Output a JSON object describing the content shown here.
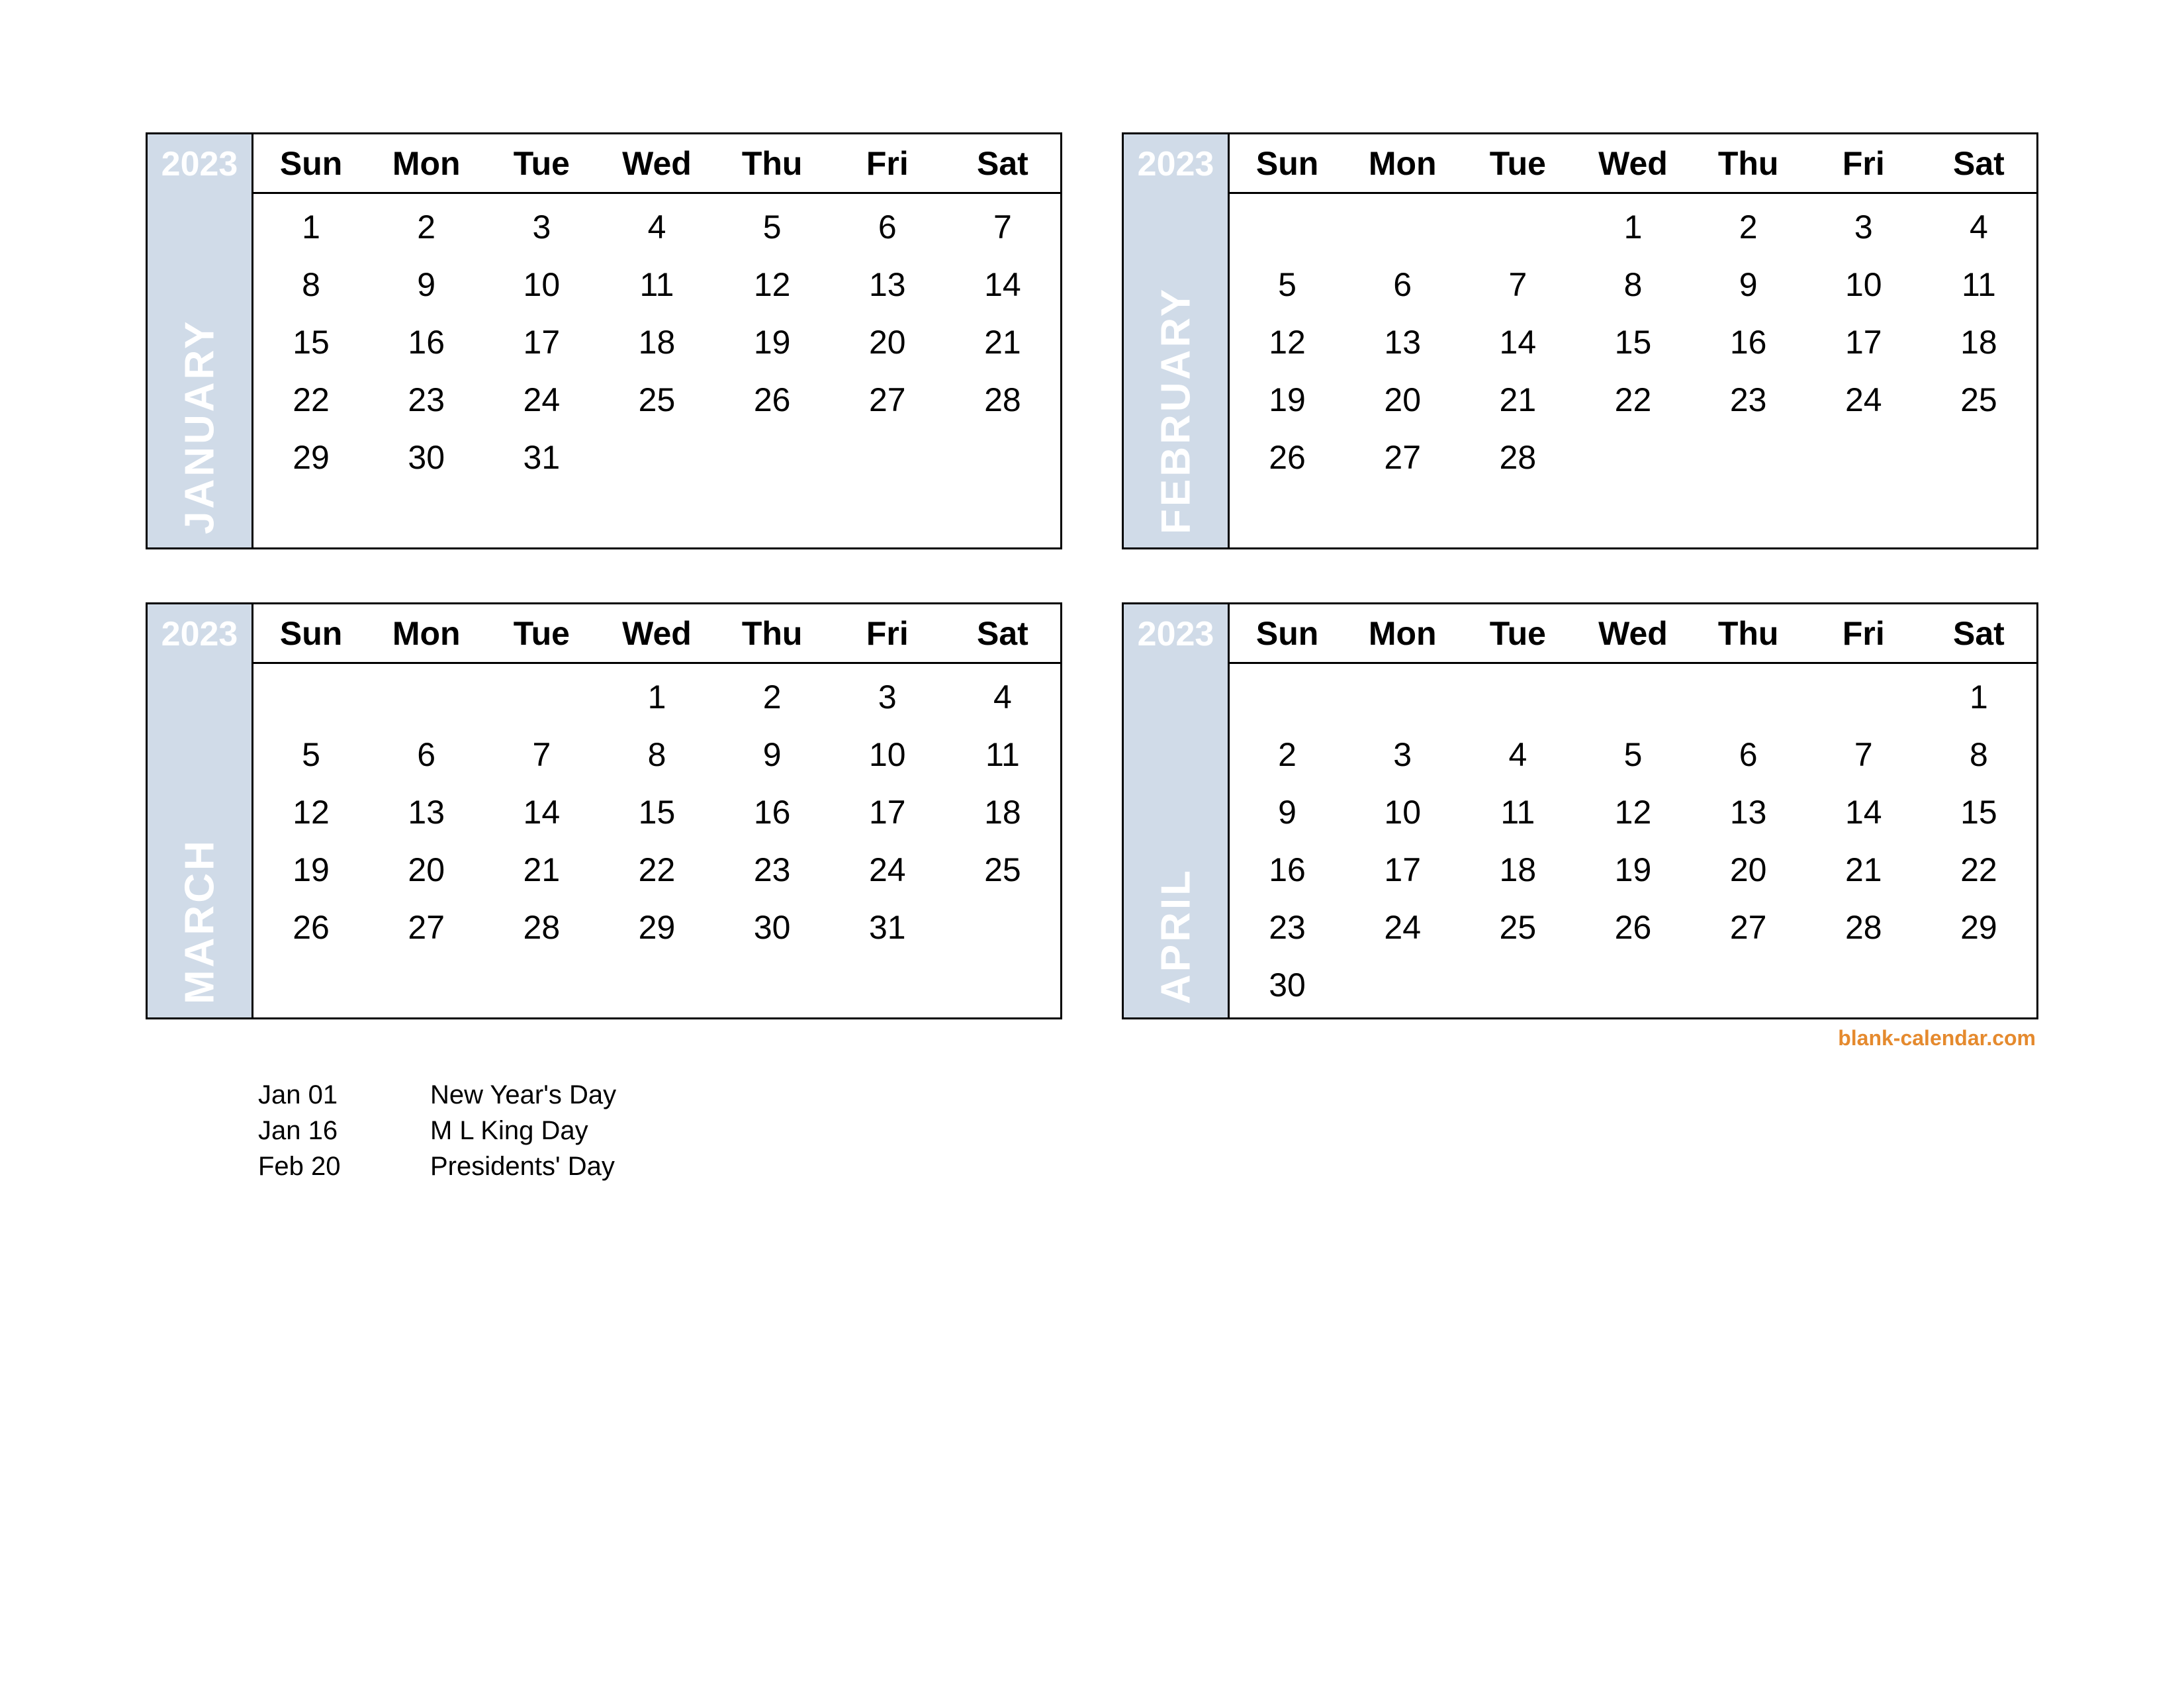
{
  "year": "2023",
  "dow": [
    "Sun",
    "Mon",
    "Tue",
    "Wed",
    "Thu",
    "Fri",
    "Sat"
  ],
  "months": [
    {
      "name": "JANUARY",
      "start": 0,
      "days": 31
    },
    {
      "name": "FEBRUARY",
      "start": 3,
      "days": 28
    },
    {
      "name": "MARCH",
      "start": 3,
      "days": 31
    },
    {
      "name": "APRIL",
      "start": 6,
      "days": 30
    }
  ],
  "holidays": [
    {
      "date": "Jan 01",
      "name": "New Year's Day"
    },
    {
      "date": "Jan 16",
      "name": "M L King Day"
    },
    {
      "date": "Feb 20",
      "name": "Presidents' Day"
    }
  ],
  "footer": "blank-calendar.com"
}
